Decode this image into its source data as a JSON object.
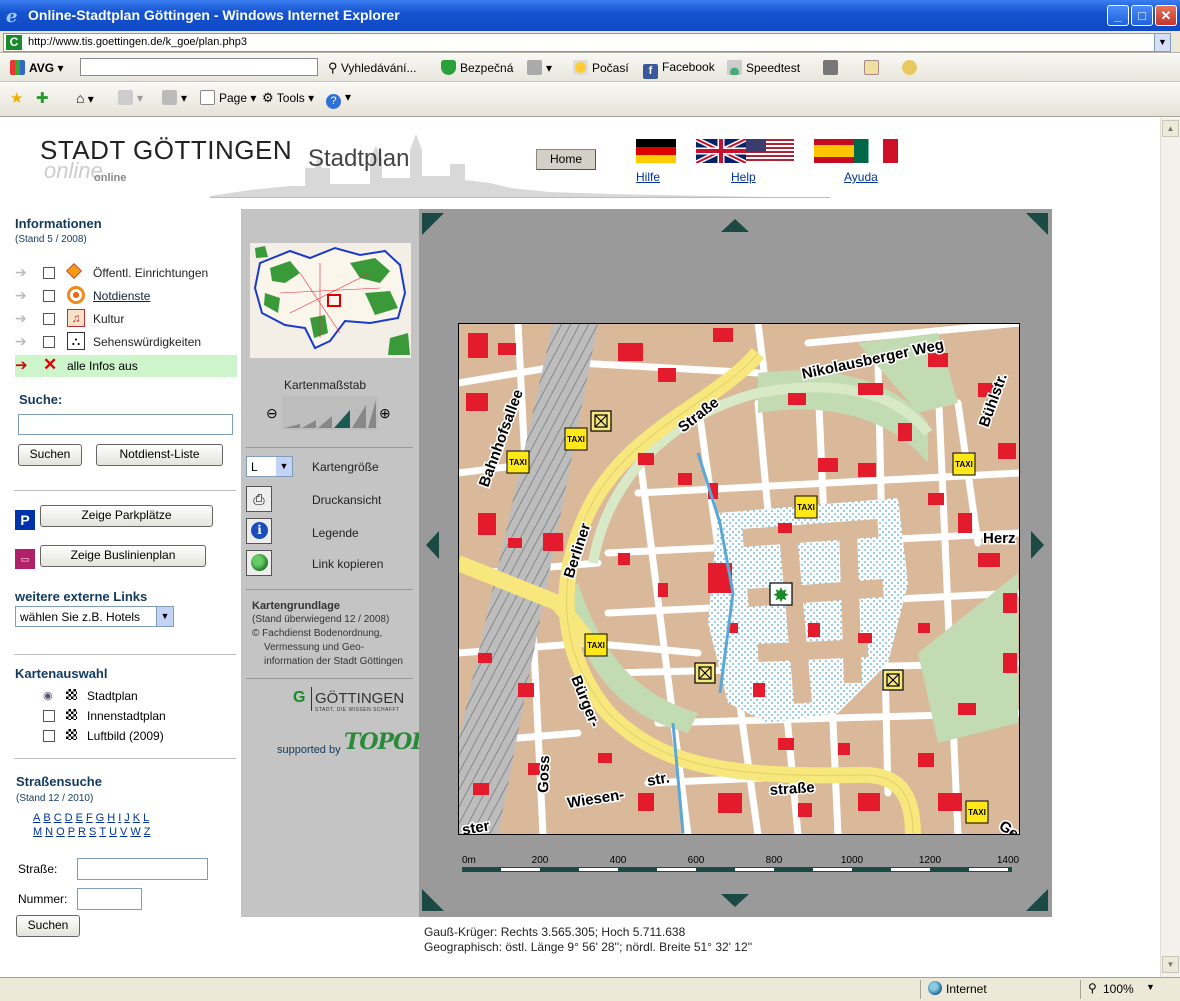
{
  "window": {
    "title": "Online-Stadtplan Göttingen - Windows Internet Explorer",
    "url": "http://www.tis.goettingen.de/k_goe/plan.php3"
  },
  "toolbar1": {
    "avg": "AVG",
    "search": "Vyhledávání...",
    "safe": "Bezpečná",
    "weather": "Počasí",
    "facebook": "Facebook",
    "speedtest": "Speedtest"
  },
  "toolbar2": {
    "page": "Page",
    "tools": "Tools"
  },
  "header": {
    "logo": "STADT GÖTTINGEN",
    "logo_online": "online",
    "logo_online_small": "online",
    "section": "Stadtplan",
    "home": "Home",
    "help_de": "Hilfe",
    "help_en": "Help",
    "help_es": "Ayuda"
  },
  "info": {
    "title": "Informationen",
    "stand": "(Stand 5 / 2008)",
    "items": [
      {
        "label": "Öffentl. Einrichtungen"
      },
      {
        "label": "Notdienste"
      },
      {
        "label": "Kultur"
      },
      {
        "label": "Sehenswürdigkeiten"
      }
    ],
    "all_off": "alle Infos aus"
  },
  "search": {
    "title": "Suche:",
    "button": "Suchen",
    "notdienst": "Notdienst-Liste"
  },
  "parking": "Zeige Parkplätze",
  "bus": "Zeige Buslinienplan",
  "external": {
    "title": "weitere externe Links",
    "selected": "wählen Sie z.B. Hotels"
  },
  "mapselect": {
    "title": "Kartenauswahl",
    "options": [
      {
        "label": "Stadtplan"
      },
      {
        "label": "Innenstadtplan"
      },
      {
        "label": "Luftbild (2009)"
      }
    ]
  },
  "streetsearch": {
    "title": "Straßensuche",
    "stand": "(Stand 12 / 2010)",
    "row1": [
      "A",
      "B",
      "C",
      "D",
      "E",
      "F",
      "G",
      "H",
      "I",
      "J",
      "K",
      "L"
    ],
    "row2": [
      "M",
      "N",
      "O",
      "P",
      "R",
      "S",
      "T",
      "U",
      "V",
      "W",
      "Z"
    ],
    "street_label": "Straße:",
    "number_label": "Nummer:",
    "button": "Suchen"
  },
  "mid": {
    "scale_title": "Kartenmaßstab",
    "size_value": "L",
    "size_label": "Kartengröße",
    "print": "Druckansicht",
    "legend": "Legende",
    "link": "Link kopieren",
    "basis_title": "Kartengrundlage",
    "basis_lines": [
      "(Stand überwiegend 12 / 2008)",
      "© Fachdienst Bodenordnung,",
      "Vermessung und Geo-",
      "information der Stadt Göttingen"
    ],
    "gott_logo": "GÖTTINGEN",
    "gott_sub": "STADT, DIE WISSEN SCHAFFT",
    "supported": "supported by",
    "topol": "TOPOL"
  },
  "map": {
    "streets": [
      {
        "text": "Nikolausberger Weg"
      },
      {
        "text": "Bühlstr."
      },
      {
        "text": "Bahnhofsallee"
      },
      {
        "text": "Straße"
      },
      {
        "text": "Berliner"
      },
      {
        "text": "Herz"
      },
      {
        "text": "Bürger-"
      },
      {
        "text": "straße"
      },
      {
        "text": "Wiesen-"
      },
      {
        "text": "str."
      },
      {
        "text": "Goss"
      },
      {
        "text": "ster"
      },
      {
        "text": "Ge"
      }
    ],
    "taxi": "TAXI",
    "scale_ticks": [
      "0m",
      "200",
      "400",
      "600",
      "800",
      "1000",
      "1200",
      "1400"
    ]
  },
  "coords": {
    "gk": "Gauß-Krüger: Rechts 3.565.305; Hoch 5.711.638",
    "geo": "Geographisch: östl. Länge 9° 56' 28''; nördl. Breite 51° 32' 12''"
  },
  "status": {
    "zone": "Internet",
    "zoom": "100%"
  },
  "colors": {
    "link": "#003399",
    "heading": "#123a5e",
    "map_frame": "#9a9a9a",
    "arrow": "#1b4a44",
    "building": "#e31b2c",
    "main_road": "#f7e77c"
  }
}
